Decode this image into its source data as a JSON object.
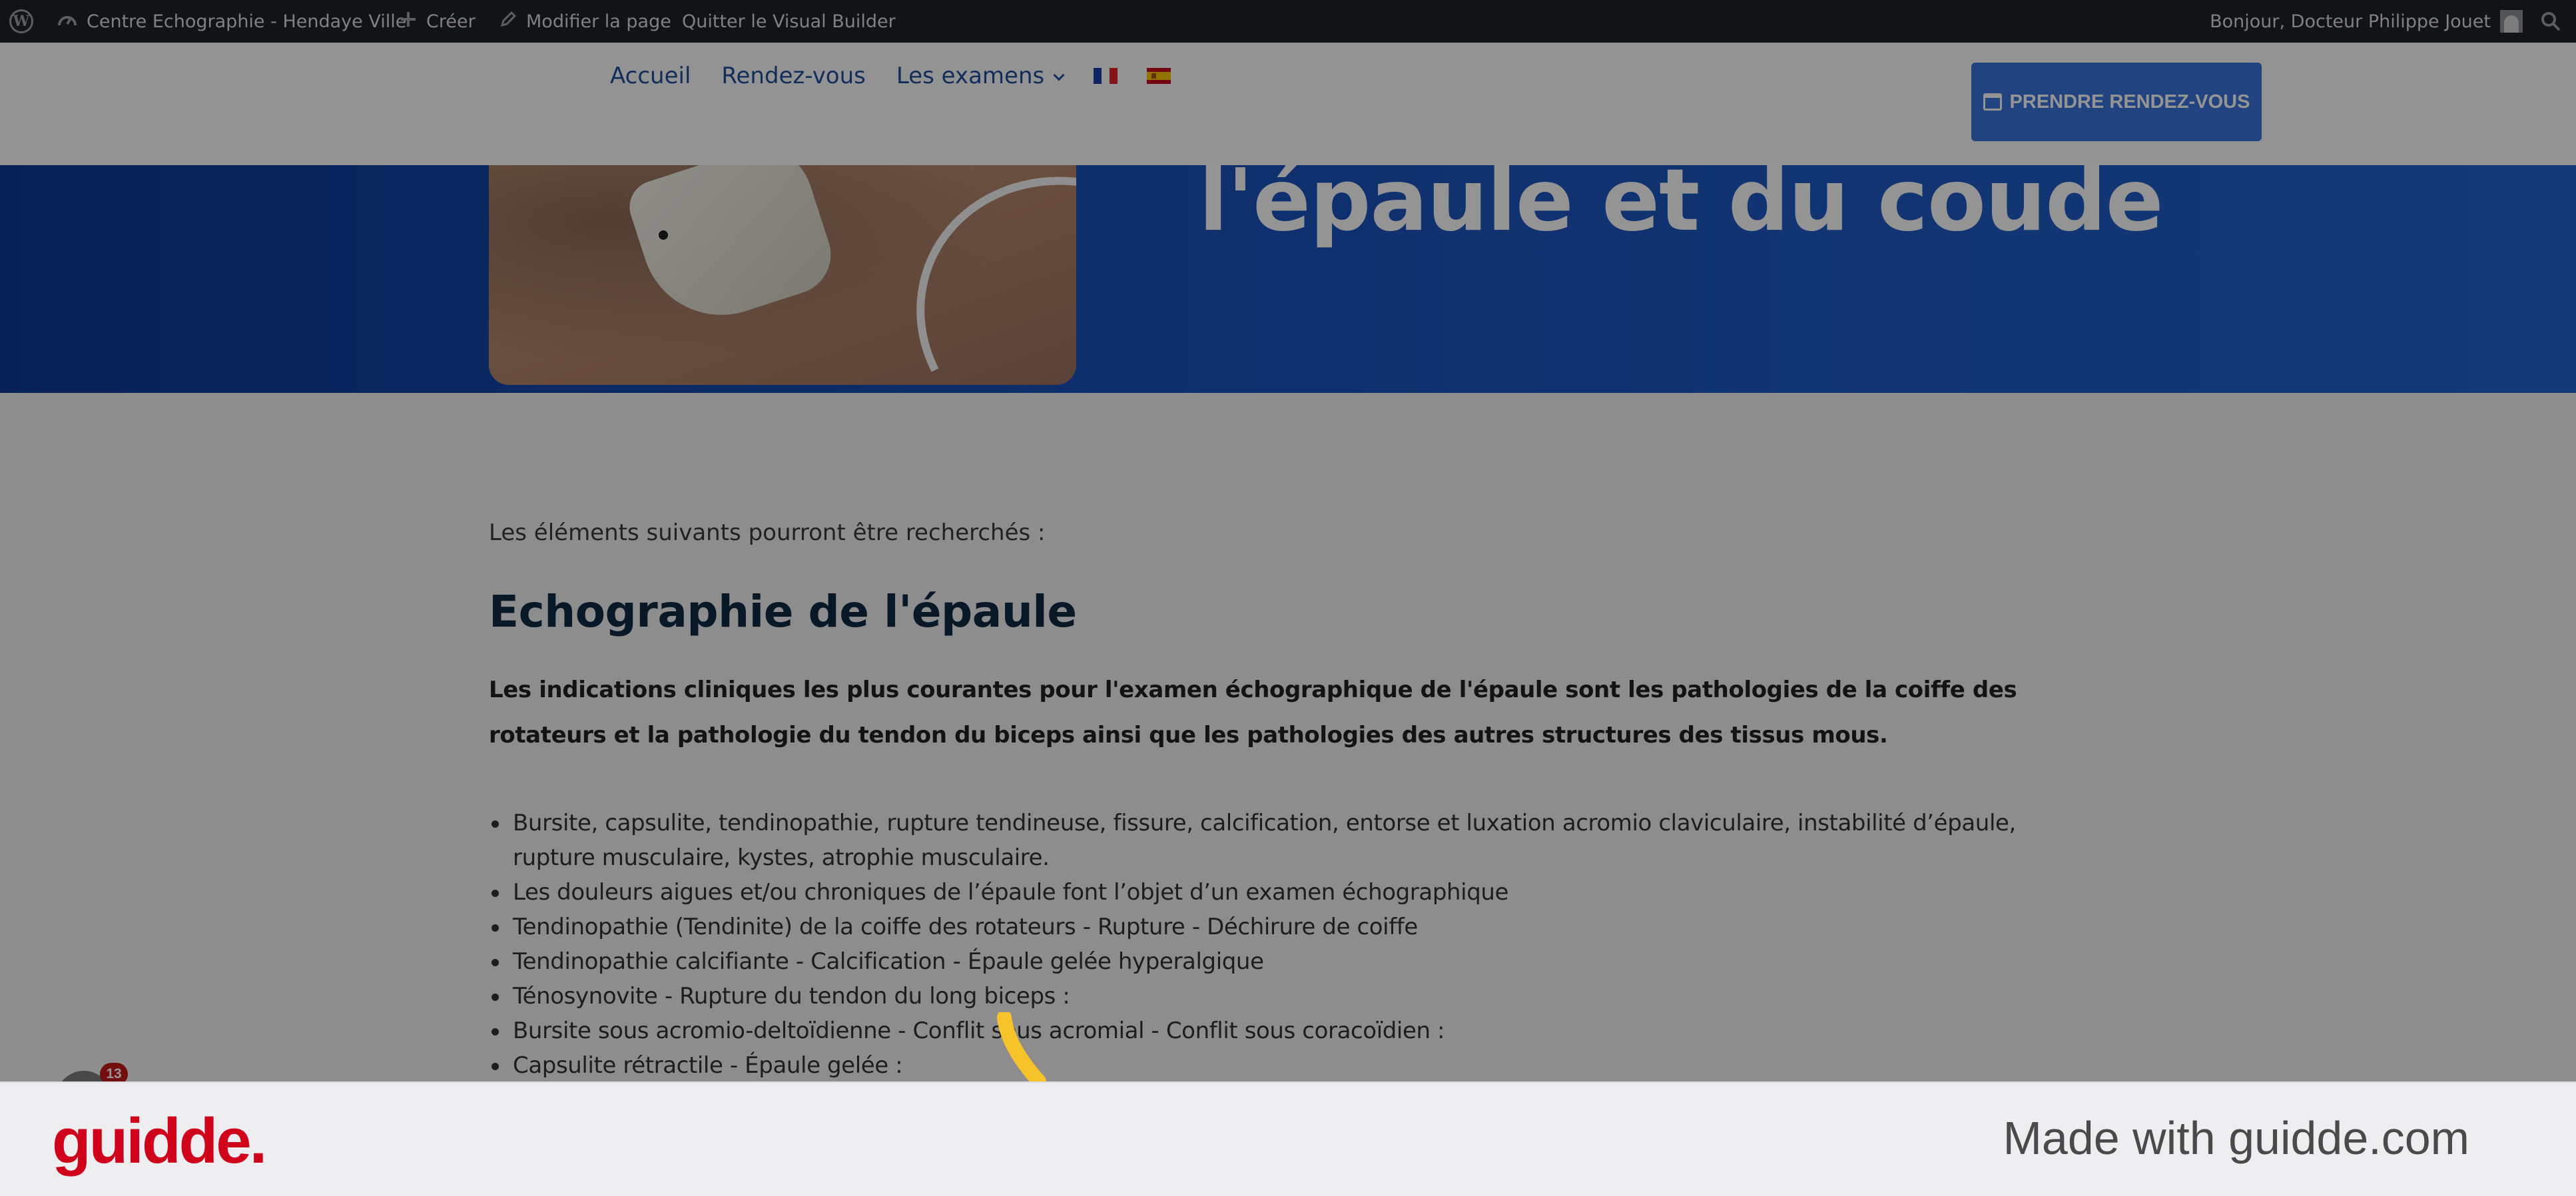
{
  "admin_bar": {
    "site_name": "Centre Echographie - Hendaye Ville",
    "new_label": "Créer",
    "edit_label": "Modifier la page",
    "exit_builder_label": "Quitter le Visual Builder",
    "greeting": "Bonjour, Docteur Philippe Jouet",
    "icons": [
      "wordpress-logo-icon",
      "dashboard-icon",
      "plus-icon",
      "pencil-icon",
      "user-avatar",
      "search-icon"
    ]
  },
  "header": {
    "nav": {
      "home": "Accueil",
      "appointments": "Rendez-vous",
      "exams": "Les examens"
    },
    "languages": [
      "fr-flag",
      "es-flag"
    ],
    "cta_label": "PRENDRE RENDEZ-VOUS",
    "cta_icon": "calendar-icon",
    "cta_color": "#3a74dc"
  },
  "hero": {
    "title_line_2": "l'épaule et du coude",
    "background_color": "#1a52bb"
  },
  "content": {
    "intro": "Les éléments suivants pourront être recherchés :",
    "heading": "Echographie de l'épaule",
    "lead": "Les indications cliniques les plus courantes pour l'examen échographique de l'épaule sont les pathologies de la coiffe des rotateurs et la pathologie du tendon du biceps ainsi que les pathologies des autres structures des tissus mous.",
    "bullets": [
      "Bursite, capsulite, tendinopathie, rupture tendineuse, fissure, calcification, entorse et luxation acromio claviculaire, instabilité d’épaule, rupture musculaire, kystes, atrophie musculaire.",
      "Les douleurs aigues et/ou chroniques de l’épaule font l’objet d’un examen échographique",
      "Tendinopathie (Tendinite) de la coiffe des rotateurs - Rupture - Déchirure de coiffe",
      "Tendinopathie calcifiante - Calcification - Épaule gelée hyperalgique",
      "Ténosynovite - Rupture du tendon du long biceps :",
      "Bursite sous acromio-deltoïdienne - Conflit sous acromial - Conflit sous coracoïdien :",
      "Capsulite rétractile - Épaule gelée :"
    ]
  },
  "notification": {
    "count": "13"
  },
  "footer": {
    "brand": "guidde.",
    "made_with": "Made with guidde.com",
    "brand_color": "#d0021b"
  }
}
